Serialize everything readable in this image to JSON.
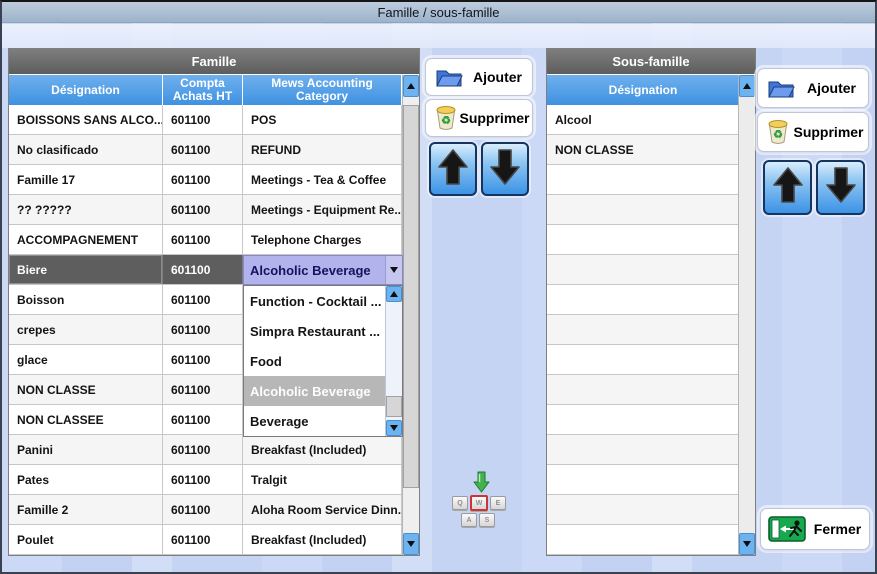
{
  "window": {
    "title": "Famille / sous-famille"
  },
  "famille_panel": {
    "title": "Famille",
    "columns": [
      "Désignation",
      "Compta Achats HT",
      "Mews Accounting Category"
    ],
    "rows": [
      {
        "designation": "BOISSONS SANS ALCO...",
        "compta": "601100",
        "mews": "POS"
      },
      {
        "designation": "No clasificado",
        "compta": "601100",
        "mews": "REFUND"
      },
      {
        "designation": "Famille 17",
        "compta": "601100",
        "mews": "Meetings - Tea & Coffee"
      },
      {
        "designation": "?? ?????",
        "compta": "601100",
        "mews": "Meetings - Equipment Re..."
      },
      {
        "designation": "ACCOMPAGNEMENT",
        "compta": "601100",
        "mews": "Telephone Charges"
      },
      {
        "designation": "Biere",
        "compta": "601100",
        "mews": "Alcoholic Beverage",
        "selected": true
      },
      {
        "designation": "Boisson",
        "compta": "601100",
        "mews": ""
      },
      {
        "designation": "crepes",
        "compta": "601100",
        "mews": ""
      },
      {
        "designation": "glace",
        "compta": "601100",
        "mews": ""
      },
      {
        "designation": "NON CLASSE",
        "compta": "601100",
        "mews": ""
      },
      {
        "designation": "NON CLASSEE",
        "compta": "601100",
        "mews": ""
      },
      {
        "designation": "Panini",
        "compta": "601100",
        "mews": "Breakfast (Included)"
      },
      {
        "designation": "Pates",
        "compta": "601100",
        "mews": "Tralgit"
      },
      {
        "designation": "Famille 2",
        "compta": "601100",
        "mews": "Aloha Room Service Dinn..."
      },
      {
        "designation": "Poulet",
        "compta": "601100",
        "mews": "Breakfast (Included)"
      }
    ],
    "buttons": {
      "ajouter": "Ajouter",
      "supprimer": "Supprimer"
    }
  },
  "category_dropdown": {
    "value": "Alcoholic Beverage",
    "options": [
      "Function - Cocktail ...",
      "Simpra Restaurant ...",
      "Food",
      "Alcoholic Beverage",
      "Beverage"
    ],
    "highlighted_option": "Alcoholic Beverage"
  },
  "sous_famille_panel": {
    "title": "Sous-famille",
    "columns": [
      "Désignation"
    ],
    "rows": [
      "Alcool",
      "NON CLASSE"
    ],
    "buttons": {
      "ajouter": "Ajouter",
      "supprimer": "Supprimer",
      "fermer": "Fermer"
    }
  },
  "keyboard_icon": {
    "keys": [
      "Q",
      "W",
      "E",
      "A",
      "S"
    ]
  },
  "colors": {
    "column_header_blue": "#4D9BE6",
    "group_header_gray": "#666666",
    "selected_row_gray": "#5E5E5E",
    "combo_lavender": "#B2B3EC",
    "scroll_button_blue": "#6DB3F2",
    "fermer_green": "#17A94E",
    "background_periwinkle": "#C7D5F3",
    "titlebar_blue_gray": "#AEC1D6"
  }
}
